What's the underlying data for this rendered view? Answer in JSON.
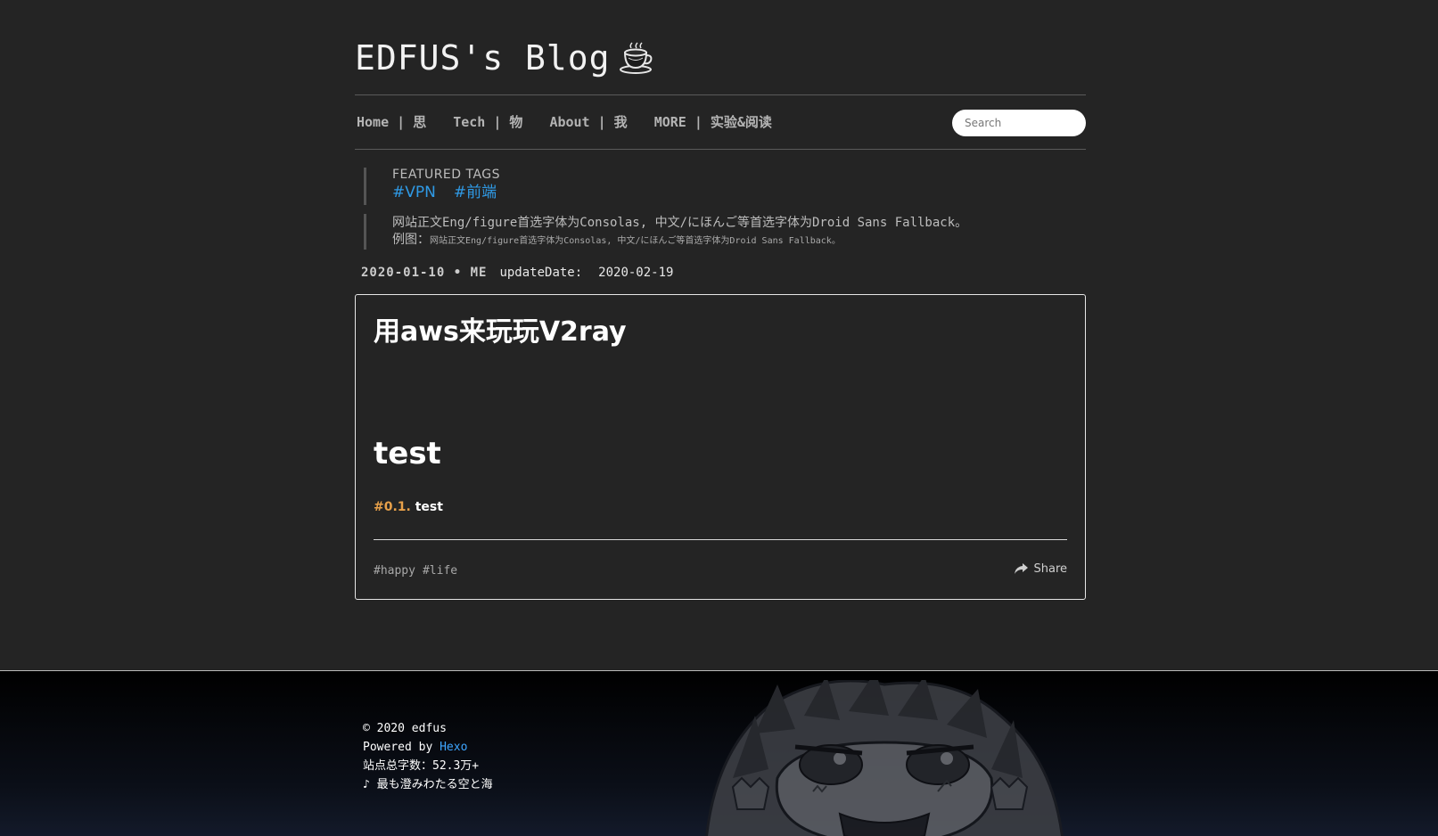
{
  "header": {
    "site_title": "EDFUS's Blog"
  },
  "nav": {
    "items": [
      {
        "label": "Home | 思"
      },
      {
        "label": "Tech | 物"
      },
      {
        "label": "About | 我"
      },
      {
        "label": "MORE | 实验&阅读"
      }
    ],
    "search_placeholder": "Search"
  },
  "featured": {
    "label": "FEATURED TAGS",
    "tags": [
      "#VPN",
      "#前端"
    ]
  },
  "notice": {
    "main": "网站正文Eng/figure首选字体为Consolas, 中文/にほんご等首选字体为Droid Sans Fallback。",
    "example_label": "例图：",
    "example_text": "网站正文Eng/figure首选字体为Consolas, 中文/にほんご等首选字体为Droid Sans Fallback。"
  },
  "post_meta": {
    "date_author": "2020-01-10 • ME",
    "update_label": "updateDate:",
    "update_value": "2020-02-19"
  },
  "post": {
    "title": "用aws来玩玩V2ray",
    "heading": "test",
    "toc_number": "#0.1.",
    "toc_text": "test",
    "tags": [
      "#happy",
      "#life"
    ],
    "share_label": "Share"
  },
  "footer": {
    "copyright": "© 2020 edfus",
    "powered_prefix": "Powered by",
    "powered_link": "Hexo",
    "word_count": "站点总字数：52.3万+",
    "music": "♪ 最も澄みわたる空と海"
  },
  "colors": {
    "background": "#242424",
    "link_blue": "#2f9ae6",
    "toc_orange": "#e8a14a",
    "footer_link": "#3ea6ff"
  },
  "icons": [
    "coffee-cup-icon",
    "share-icon"
  ]
}
